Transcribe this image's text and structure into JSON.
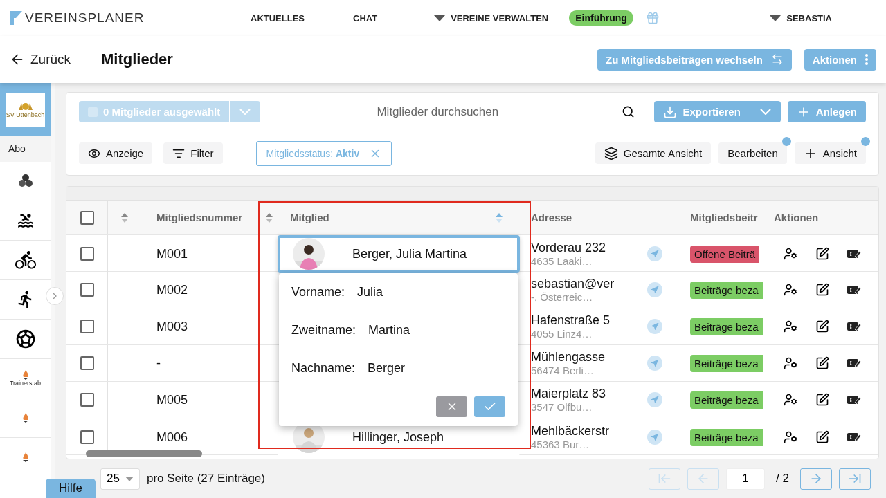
{
  "nav": {
    "brand": "VEREINSPLANER",
    "items": [
      {
        "label": "AKTUELLES",
        "dropdown": false
      },
      {
        "label": "CHAT",
        "dropdown": false
      },
      {
        "label": "VEREINE VERWALTEN",
        "dropdown": true
      }
    ],
    "badge": "Einführung",
    "user": "SEBASTIA"
  },
  "header": {
    "back": "Zurück",
    "title": "Mitglieder",
    "buttons": [
      {
        "label": "Zu Mitgliedsbeiträgen wechseln"
      },
      {
        "label": "Aktionen"
      }
    ]
  },
  "sidebar": {
    "club": "SV Uttenbach",
    "club_selected": true,
    "items": [
      {
        "kind": "text",
        "label": "Abo"
      },
      {
        "kind": "triathlon"
      },
      {
        "kind": "swim"
      },
      {
        "kind": "bike"
      },
      {
        "kind": "run"
      },
      {
        "kind": "soccer"
      },
      {
        "kind": "flame",
        "label": "Trainerstab"
      },
      {
        "kind": "flame"
      },
      {
        "kind": "flame"
      }
    ]
  },
  "toolbar": {
    "selection": {
      "label": "0 Mitglieder ausgewählt",
      "disabled": true
    },
    "search": {
      "placeholder": "Mitglieder durchsuchen"
    },
    "export": "Exportieren",
    "create": "Anlegen",
    "view_buttons": [
      {
        "label": "Anzeige"
      },
      {
        "label": "Filter"
      }
    ],
    "chip": "Mitgliedsstatus: **Aktiv**",
    "right_buttons": [
      {
        "label": "Gesamte Ansicht",
        "dot": false
      },
      {
        "label": "Bearbeiten",
        "dot": true
      },
      {
        "label": "Ansicht",
        "dot": true
      }
    ]
  },
  "table": {
    "header_checked": false,
    "columns": [
      {
        "label": "Mitgliedsnummer",
        "sort_handle": true,
        "sorted": false
      },
      {
        "label": "Mitglied",
        "sort_handle": true,
        "sorted": true
      },
      {
        "label": "Adresse",
        "sort_handle": false,
        "sorted": false
      },
      {
        "label": "Mitgliedsbeitr",
        "sort_handle": false,
        "sorted": false
      },
      {
        "label": "Aktionen",
        "sort_handle": false,
        "sorted": false
      }
    ],
    "rows": [
      {
        "checked": false,
        "editing": true,
        "number": "M001",
        "member": "Berger, Julia Martina",
        "address": "Vorderau 232",
        "city": "4635 Laaki…",
        "status": "Offene Beiträ",
        "color": "#d9546a"
      },
      {
        "checked": false,
        "editing": false,
        "number": "M002",
        "address": "sebastian@ver",
        "city": "-, Österreic…",
        "status": "Beiträge beza",
        "color": "#7ccd64"
      },
      {
        "checked": false,
        "editing": false,
        "number": "M003",
        "address": "Hafenstraße 5",
        "city": "4055 Linz4…",
        "status": "Beiträge beza",
        "color": "#7ccd64"
      },
      {
        "checked": false,
        "editing": false,
        "number": "-",
        "address": "Mühlengasse",
        "city": "56474 Berli…",
        "status": "Beiträge beza",
        "color": "#7ccd64"
      },
      {
        "checked": false,
        "editing": false,
        "number": "M005",
        "address": "Maierplatz 83",
        "city": "3547 Olfbu…",
        "status": "Beiträge beza",
        "color": "#7ccd64"
      },
      {
        "checked": false,
        "editing": false,
        "number": "M006",
        "member": "Hillinger, Joseph",
        "address": "Mehlbäckerstr",
        "city": "45363 Bur…",
        "status": "Beiträge beza",
        "color": "#7ccd64"
      }
    ]
  },
  "editor": {
    "fields": [
      {
        "label": "Vorname:",
        "value": "Julia"
      },
      {
        "label": "Zweitname:",
        "value": "Martina"
      },
      {
        "label": "Nachname:",
        "value": "Berger"
      }
    ],
    "buttons": [
      {
        "kind": "cancel"
      },
      {
        "kind": "confirm"
      }
    ]
  },
  "footer": {
    "page_size": "25",
    "summary": "pro Seite (27 Einträge)",
    "page": "1",
    "total": "/ 2",
    "pager": [
      {
        "kind": "first",
        "disabled": true
      },
      {
        "kind": "prev",
        "disabled": true
      },
      {
        "kind": "next",
        "disabled": false
      },
      {
        "kind": "last",
        "disabled": false
      }
    ]
  },
  "help": "Hilfe"
}
